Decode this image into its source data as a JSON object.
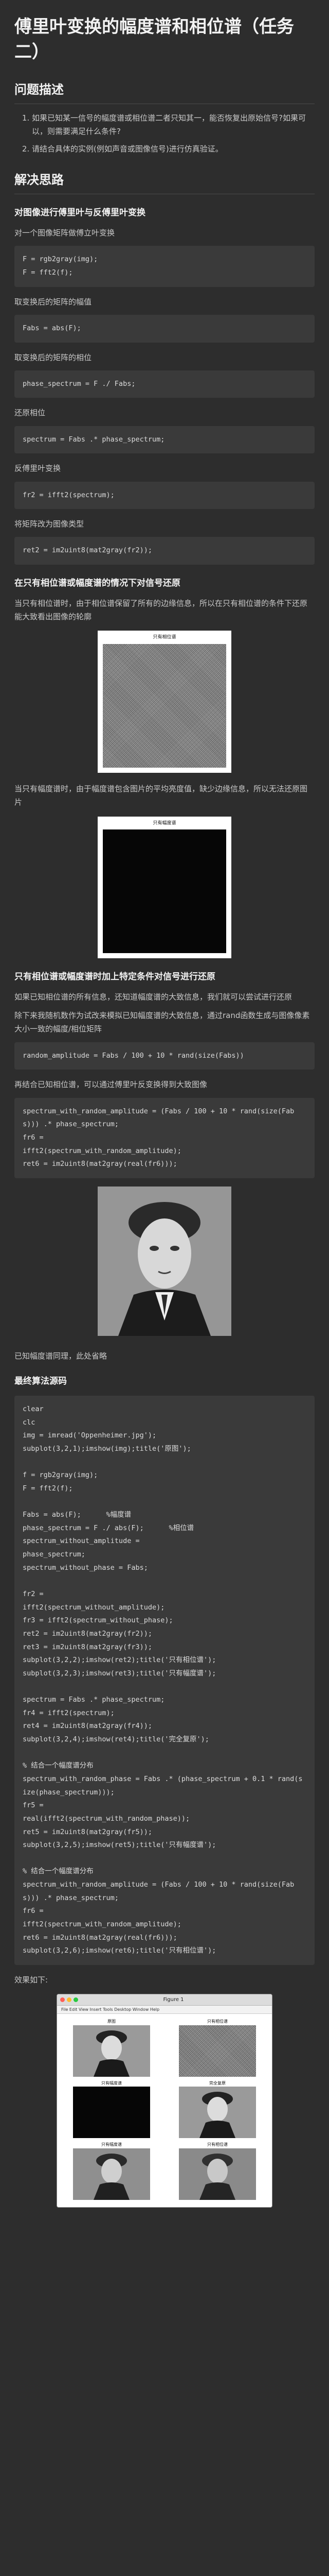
{
  "title": "傅里叶变换的幅度谱和相位谱（任务二）",
  "problem": {
    "heading": "问题描述",
    "items": [
      "如果已知某一信号的幅度谱或相位谱二者只知其一，能否恢复出原始信号?如果可以，则需要满足什么条件?",
      "请结合具体的实例(例如声音或图像信号)进行仿真验证。"
    ]
  },
  "approach": {
    "heading": "解决思路",
    "sub1": {
      "heading": "对图像进行傅里叶与反傅里叶变换",
      "p1": "对一个图像矩阵做傅立叶变换",
      "code1": [
        "F = rgb2gray(img);",
        "F = fft2(f);"
      ],
      "p2": "取变换后的矩阵的幅值",
      "code2": [
        "Fabs = abs(F);"
      ],
      "p3": "取变换后的矩阵的相位",
      "code3": [
        "phase_spectrum = F ./ Fabs;"
      ],
      "p4": "还原相位",
      "code4": [
        "spectrum = Fabs .* phase_spectrum;"
      ],
      "p5": "反傅里叶变换",
      "code5": [
        "fr2 = ifft2(spectrum);"
      ],
      "p6": "将矩阵改为图像类型",
      "code6": [
        "ret2 = im2uint8(mat2gray(fr2));"
      ]
    },
    "sub2": {
      "heading": "在只有相位谱或幅度谱的情况下对信号还原",
      "p1": "当只有相位谱时，由于相位谱保留了所有的边缘信息，所以在只有相位谱的条件下还原能大致看出图像的轮廓",
      "fig1_title": "只有相位谱",
      "p2": "当只有幅度谱时，由于幅度谱包含图片的平均亮度值，缺少边缘信息，所以无法还原图片",
      "fig2_title": "只有幅度谱"
    },
    "sub3": {
      "heading": "只有相位谱或幅度谱时加上特定条件对信号进行还原",
      "p1": "如果已知相位谱的所有信息，还知道幅度谱的大致信息，我们就可以尝试进行还原",
      "p2": "除下来我随机数作为试改来模拟已知幅度谱的大致信息，通过rand函数生成与图像像素大小一致的幅度/相位矩阵",
      "code1": [
        "random_amplitude = Fabs / 100 + 10 * rand(size(Fabs))"
      ],
      "p3": "再结合已知相位谱，可以通过傅里叶反变换得到大致图像",
      "code2": [
        "spectrum_with_random_amplitude = (Fabs / 100 + 10 * rand(size(Fabs))) .* phase_spectrum;",
        "fr6 =",
        "ifft2(spectrum_with_random_amplitude);",
        "ret6 = im2uint8(mat2gray(real(fr6)));"
      ],
      "p4": "已知幅度谱同理，此处省略"
    },
    "final": {
      "heading": "最终算法源码",
      "code": [
        "clear",
        "clc",
        "img = imread('Oppenheimer.jpg');",
        "subplot(3,2,1);imshow(img);title('原图');",
        "",
        "f = rgb2gray(img);",
        "F = fft2(f);",
        "",
        "Fabs = abs(F);      %幅度谱",
        "phase_spectrum = F ./ abs(F);      %相位谱",
        "spectrum_without_amplitude =",
        "phase_spectrum;",
        "spectrum_without_phase = Fabs;",
        "",
        "fr2 =",
        "ifft2(spectrum_without_amplitude);",
        "fr3 = ifft2(spectrum_without_phase);",
        "ret2 = im2uint8(mat2gray(fr2));",
        "ret3 = im2uint8(mat2gray(fr3));",
        "subplot(3,2,2);imshow(ret2);title('只有相位谱');",
        "subplot(3,2,3);imshow(ret3);title('只有幅度谱');",
        "",
        "spectrum = Fabs .* phase_spectrum;",
        "fr4 = ifft2(spectrum);",
        "ret4 = im2uint8(mat2gray(fr4));",
        "subplot(3,2,4);imshow(ret4);title('完全复原');",
        "",
        "% 结合一个幅度谱分布",
        "spectrum_with_random_phase = Fabs .* (phase_spectrum + 0.1 * rand(size(phase_spectrum)));",
        "fr5 =",
        "real(ifft2(spectrum_with_random_phase));",
        "ret5 = im2uint8(mat2gray(fr5));",
        "subplot(3,2,5);imshow(ret5);title('只有幅度谱');",
        "",
        "% 结合一个幅度谱分布",
        "spectrum_with_random_amplitude = (Fabs / 100 + 10 * rand(size(Fabs))) .* phase_spectrum;",
        "fr6 =",
        "ifft2(spectrum_with_random_amplitude);",
        "ret6 = im2uint8(mat2gray(real(fr6)));",
        "subplot(3,2,6);imshow(ret6);title('只有相位谱');"
      ],
      "effect_label": "效果如下:"
    }
  },
  "figure_window": {
    "title": "Figure 1",
    "menu": "File  Edit  View  Insert  Tools  Desktop  Window  Help",
    "cells": [
      "原图",
      "只有相位谱",
      "只有幅度谱",
      "完全复原",
      "只有幅度谱",
      "只有相位谱"
    ],
    "dot_colors": [
      "#ff5f57",
      "#febc2e",
      "#28c840"
    ]
  }
}
